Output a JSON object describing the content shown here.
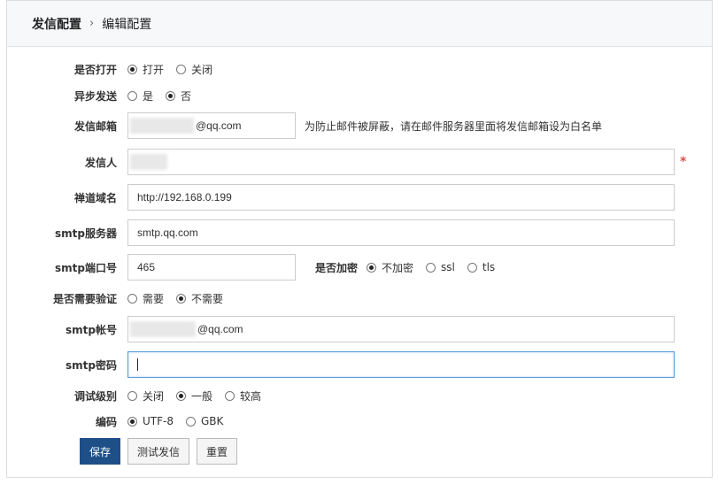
{
  "breadcrumb": {
    "first": "发信配置",
    "separator": "›",
    "second": "编辑配置"
  },
  "form": {
    "enabled": {
      "label": "是否打开",
      "options": [
        "打开",
        "关闭"
      ],
      "selected": 0
    },
    "async_send": {
      "label": "异步发送",
      "options": [
        "是",
        "否"
      ],
      "selected": 1
    },
    "sender_email": {
      "label": "发信邮箱",
      "value_visible": "@qq.com",
      "hint": "为防止邮件被屏蔽，请在邮件服务器里面将发信邮箱设为白名单"
    },
    "sender_name": {
      "label": "发信人",
      "required_mark": "*"
    },
    "zen_domain": {
      "label": "禅道域名",
      "value": "http://192.168.0.199"
    },
    "smtp_server": {
      "label": "smtp服务器",
      "value": "smtp.qq.com"
    },
    "smtp_port": {
      "label": "smtp端口号",
      "value": "465"
    },
    "encryption": {
      "label": "是否加密",
      "options": [
        "不加密",
        "ssl",
        "tls"
      ],
      "selected": 0
    },
    "require_auth": {
      "label": "是否需要验证",
      "options": [
        "需要",
        "不需要"
      ],
      "selected": 1
    },
    "smtp_account": {
      "label": "smtp帐号",
      "value_visible": "@qq.com"
    },
    "smtp_password": {
      "label": "smtp密码",
      "value": ""
    },
    "debug_level": {
      "label": "调试级别",
      "options": [
        "关闭",
        "一般",
        "较高"
      ],
      "selected": 1
    },
    "charset": {
      "label": "编码",
      "options": [
        "UTF-8",
        "GBK"
      ],
      "selected": 0
    }
  },
  "buttons": {
    "save": "保存",
    "test_send": "测试发信",
    "reset": "重置"
  },
  "colors": {
    "primary_button": "#1e4f87",
    "required": "#d9534f",
    "focus_border": "#5b9bd5"
  }
}
